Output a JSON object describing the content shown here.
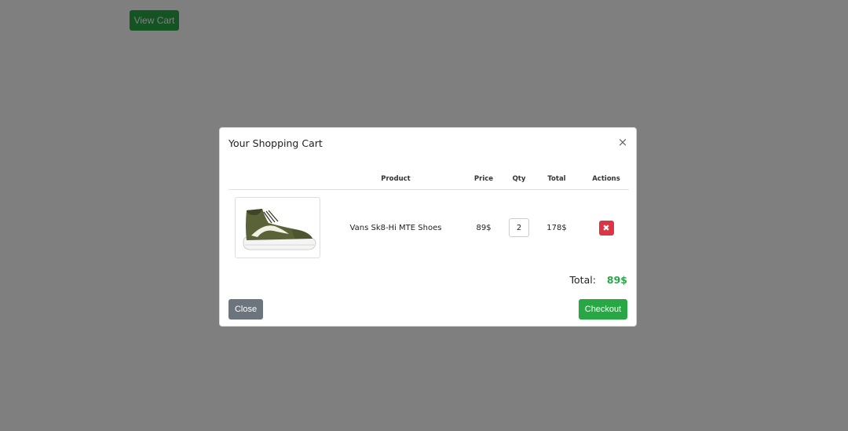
{
  "page": {
    "view_cart_label": "View Cart"
  },
  "modal": {
    "title": "Your Shopping Cart",
    "close_icon": "×",
    "table": {
      "headers": {
        "image": "",
        "product": "Product",
        "price": "Price",
        "qty": "Qty",
        "total": "Total",
        "actions": "Actions"
      },
      "rows": [
        {
          "image_icon": "sneaker-image",
          "product": "Vans Sk8-Hi MTE Shoes",
          "price": "89$",
          "qty": "2",
          "total": "178$",
          "remove_icon": "✖"
        }
      ]
    },
    "total_label": "Total:",
    "total_value": "89$",
    "close_label": "Close",
    "checkout_label": "Checkout"
  },
  "colors": {
    "success": "#28a745",
    "secondary": "#6c757d",
    "danger": "#dc3545",
    "shoe": "#5a6238"
  }
}
